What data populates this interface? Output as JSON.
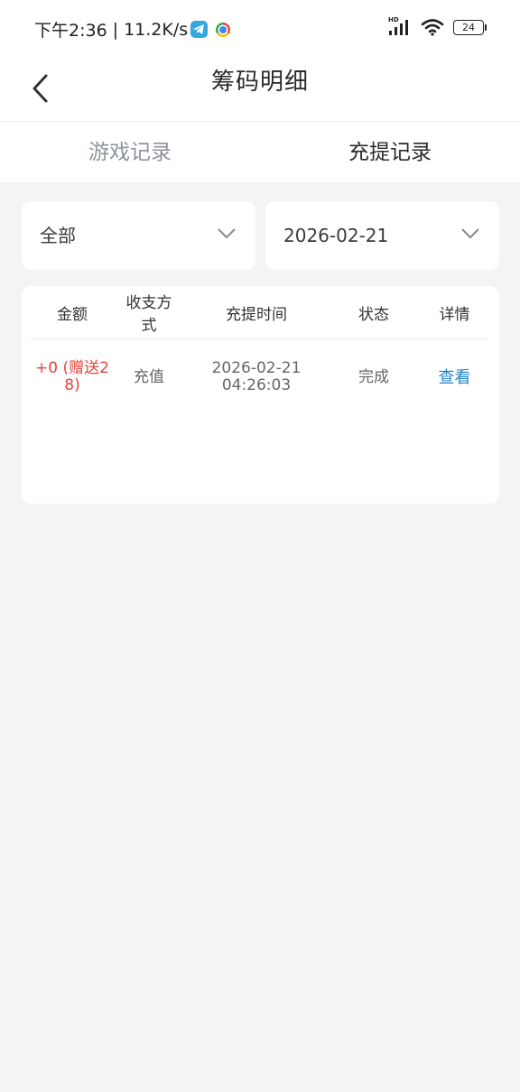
{
  "status_bar": {
    "time": "下午2:36",
    "separator": "|",
    "network_speed": "11.2K/s",
    "signal_label": "HD",
    "battery_level": "24"
  },
  "nav": {
    "title": "筹码明细"
  },
  "tabs": [
    {
      "label": "游戏记录",
      "active": false
    },
    {
      "label": "充提记录",
      "active": true
    }
  ],
  "filters": {
    "type": "全部",
    "date": "2026-02-21"
  },
  "table": {
    "columns": [
      "金额",
      "收支方式",
      "充提时间",
      "状态",
      "详情"
    ],
    "rows": [
      {
        "amount_line1": "+0 (赠送2",
        "amount_line2": "8)",
        "method": "充值",
        "time_line1": "2026-02-21",
        "time_line2": "04:26:03",
        "status": "完成",
        "detail": "查看"
      }
    ]
  },
  "colors": {
    "amount": "#e0473f",
    "link": "#1f84c9",
    "inactive_tab": "#8d939c",
    "background": "#f4f4f5"
  }
}
